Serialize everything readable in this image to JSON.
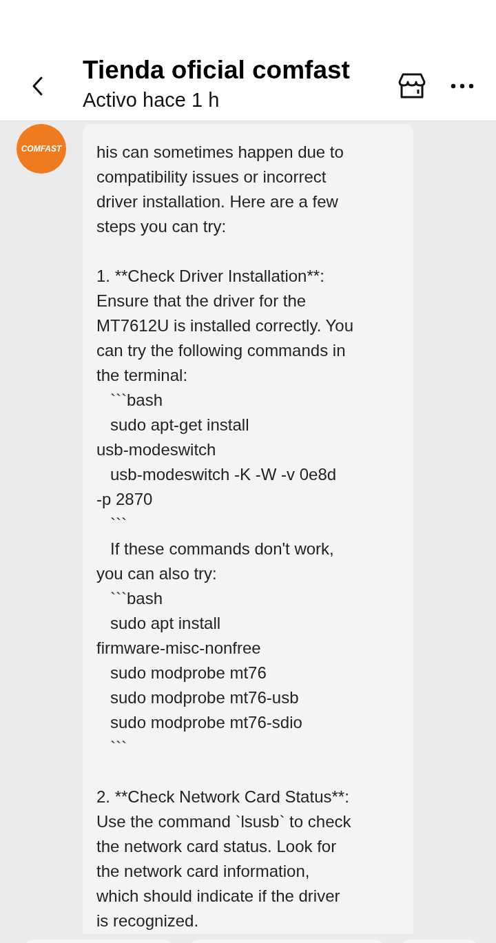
{
  "header": {
    "title": "Tienda oficial comfast",
    "subtitle": "Activo hace 1 h"
  },
  "messages": [
    {
      "avatar": {
        "label": "COMFAST"
      },
      "text": "his can sometimes happen due to\ncompatibility issues or incorrect\ndriver installation. Here are a few\nsteps you can try:\n\n1. **Check Driver Installation**:\nEnsure that the driver for the\nMT7612U is installed correctly. You\ncan try the following commands in\nthe terminal:\n   ```bash\n   sudo apt-get install\nusb-modeswitch\n   usb-modeswitch -K -W -v 0e8d\n-p 2870\n   ```\n   If these commands don't work,\nyou can also try:\n   ```bash\n   sudo apt install\nfirmware-misc-nonfree\n   sudo modprobe mt76\n   sudo modprobe mt76-usb\n   sudo modprobe mt76-sdio\n   ```\n\n2. **Check Network Card Status**:\nUse the command `lsusb` to check\nthe network card status. Look for\nthe network card information,\nwhich should indicate if the driver\nis recognized."
    }
  ],
  "chips": [
    {
      "kind": "chip"
    },
    {
      "kind": "chip"
    },
    {
      "kind": "chip"
    }
  ]
}
